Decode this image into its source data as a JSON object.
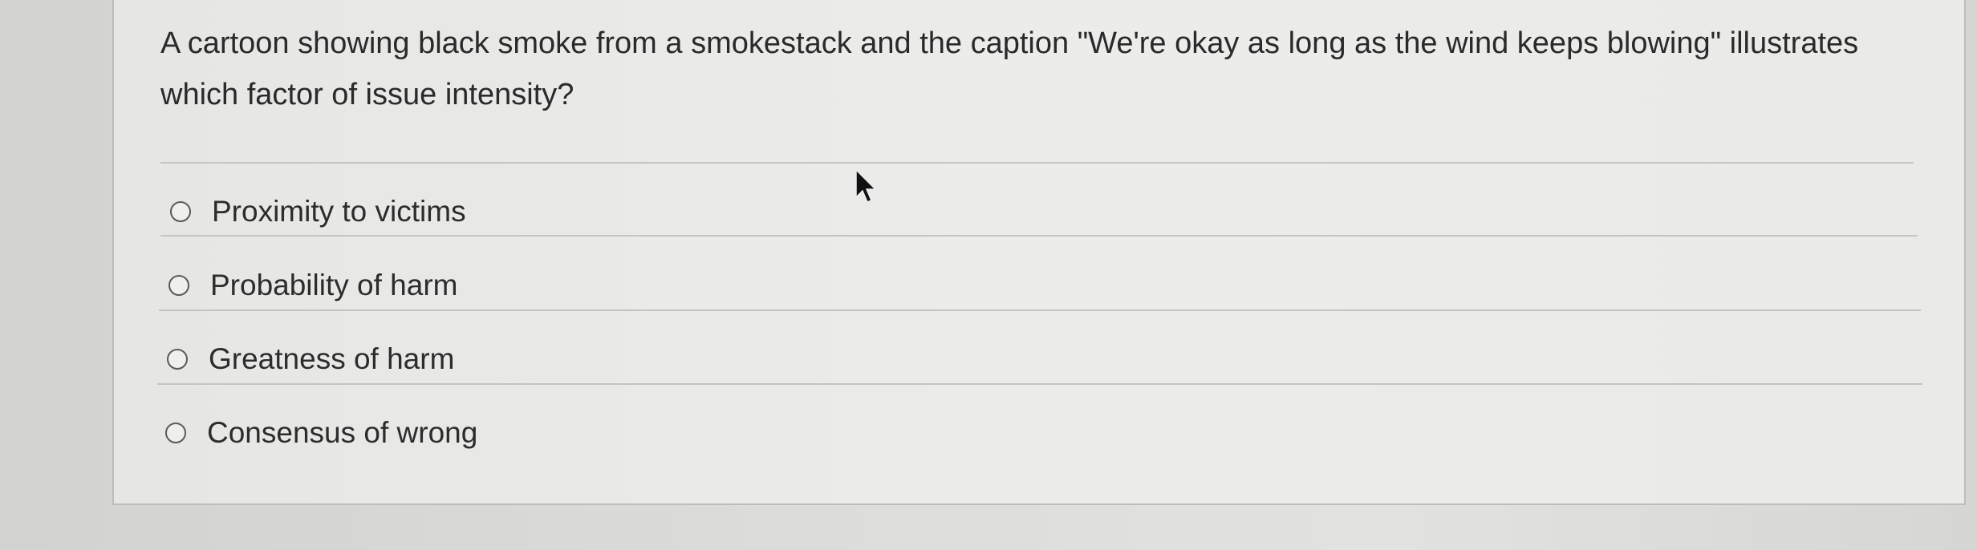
{
  "question": {
    "text": "A cartoon showing black smoke from a smokestack and the caption \"We're okay as long as the wind keeps blowing\" illustrates which factor of issue intensity?"
  },
  "answers": [
    {
      "label": "Proximity to victims",
      "selected": false
    },
    {
      "label": "Probability of harm",
      "selected": false
    },
    {
      "label": "Greatness of harm",
      "selected": false
    },
    {
      "label": "Consensus of wrong",
      "selected": false
    }
  ],
  "icons": {
    "radio": "radio-unselected-icon",
    "cursor": "mouse-pointer-icon"
  }
}
